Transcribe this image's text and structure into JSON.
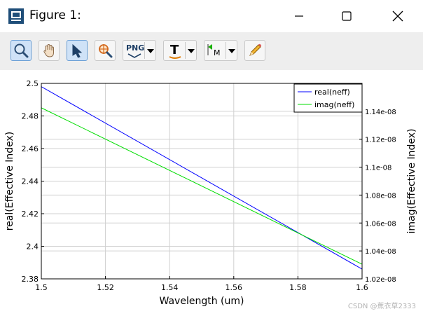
{
  "window": {
    "title": "Figure 1:",
    "controls": [
      "minimize",
      "maximize",
      "close"
    ]
  },
  "toolbar": {
    "tools": [
      {
        "name": "zoom",
        "icon": "magnifier-icon",
        "active": true
      },
      {
        "name": "pan",
        "icon": "hand-icon",
        "active": false
      },
      {
        "name": "select",
        "icon": "pointer-arrow-icon",
        "active": true
      },
      {
        "name": "zoom-to-fit",
        "icon": "target-magnifier-icon",
        "active": false
      },
      {
        "name": "export-png",
        "icon": "png-icon",
        "label": "PNG",
        "dropdown": true
      },
      {
        "name": "text",
        "icon": "text-tool-icon",
        "label": "T",
        "dropdown": true
      },
      {
        "name": "marker",
        "icon": "marker-flag-icon",
        "label": "M",
        "dropdown": true
      },
      {
        "name": "draw",
        "icon": "pencil-icon",
        "active": false
      }
    ]
  },
  "chart_data": {
    "type": "line",
    "xlabel": "Wavelength (um)",
    "ylabel_left": "real(Effective Index)",
    "ylabel_right": "imag(Effective Index)",
    "xlim": [
      1.5,
      1.6
    ],
    "ylim_left": [
      2.38,
      2.5
    ],
    "ylim_right": [
      1.02e-08,
      1.16e-08
    ],
    "x_ticks": [
      "1.5",
      "1.52",
      "1.54",
      "1.56",
      "1.58",
      "1.6"
    ],
    "x_tick_values": [
      1.5,
      1.52,
      1.54,
      1.56,
      1.58,
      1.6
    ],
    "y_left_ticks": [
      "2.5",
      "2.48",
      "2.46",
      "2.44",
      "2.42",
      "2.4",
      "2.38"
    ],
    "y_left_tick_values": [
      2.5,
      2.48,
      2.46,
      2.44,
      2.42,
      2.4,
      2.38
    ],
    "y_right_ticks": [
      "1.14e-08",
      "1.12e-08",
      "1.1e-08",
      "1.08e-08",
      "1.06e-08",
      "1.04e-08",
      "1.02e-08"
    ],
    "y_right_tick_values": [
      1.14e-08,
      1.12e-08,
      1.1e-08,
      1.08e-08,
      1.06e-08,
      1.04e-08,
      1.02e-08
    ],
    "grid": true,
    "legend_position": "top-right",
    "series": [
      {
        "name": "real(neff)",
        "axis": "left",
        "color": "#0000ff",
        "x": [
          1.5,
          1.6
        ],
        "y": [
          2.498,
          2.386
        ]
      },
      {
        "name": "imag(neff)",
        "axis": "right",
        "color": "#00dd00",
        "x": [
          1.5,
          1.6
        ],
        "y": [
          1.1425e-08,
          1.0305e-08
        ]
      }
    ]
  },
  "watermark": "CSDN @蕉衣草2333"
}
